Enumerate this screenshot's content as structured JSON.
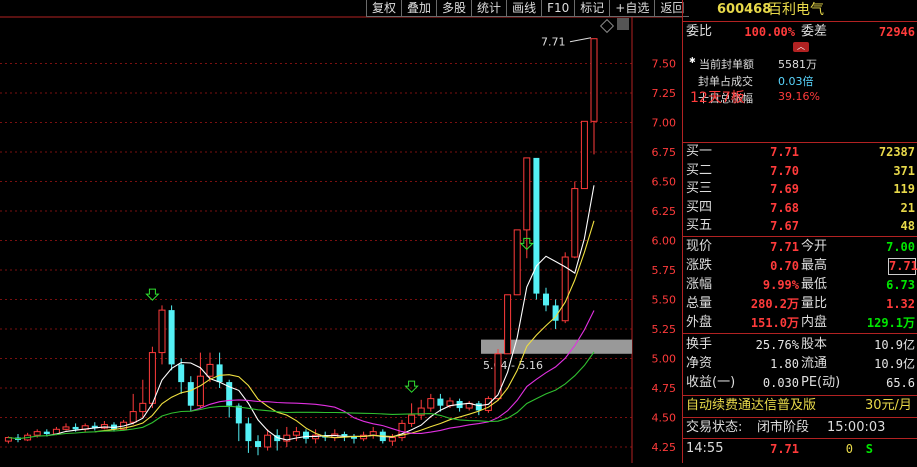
{
  "toolbar": [
    {
      "id": "fuquan",
      "label": "复权"
    },
    {
      "id": "diejia",
      "label": "叠加"
    },
    {
      "id": "duogu",
      "label": "多股"
    },
    {
      "id": "tongji",
      "label": "统计"
    },
    {
      "id": "huaxian",
      "label": "画线"
    },
    {
      "id": "f10",
      "label": "F10"
    },
    {
      "id": "biaoji",
      "label": "标记"
    },
    {
      "id": "zixuan",
      "label": "+自选"
    },
    {
      "id": "fanhui",
      "label": "返回"
    }
  ],
  "chart": {
    "price_axis": [
      "7.50",
      "7.25",
      "7.00",
      "6.75",
      "6.50",
      "6.25",
      "6.00",
      "5.75",
      "5.50",
      "5.25",
      "5.00",
      "4.75",
      "4.50",
      "4.25"
    ],
    "price_min": 4.25,
    "price_max": 7.75,
    "high_label": "7.71",
    "range_label": "5.04 - 5.16",
    "panel_title": "12天7板",
    "seal_amount_label": "当前封单额",
    "seal_amount_value": "5581万",
    "seal_ratio_label": "封单占成交",
    "seal_ratio_value": "0.03倍",
    "ten_day_label": "十日总涨幅",
    "ten_day_value": "39.16%",
    "candles": [
      [
        4.3,
        4.33,
        4.34,
        4.28
      ],
      [
        4.33,
        4.31,
        4.36,
        4.29
      ],
      [
        4.31,
        4.35,
        4.37,
        4.3
      ],
      [
        4.35,
        4.38,
        4.4,
        4.33
      ],
      [
        4.38,
        4.36,
        4.4,
        4.34
      ],
      [
        4.36,
        4.4,
        4.42,
        4.35
      ],
      [
        4.4,
        4.42,
        4.45,
        4.39
      ],
      [
        4.42,
        4.4,
        4.45,
        4.38
      ],
      [
        4.4,
        4.43,
        4.45,
        4.38
      ],
      [
        4.43,
        4.41,
        4.46,
        4.39
      ],
      [
        4.41,
        4.44,
        4.47,
        4.4
      ],
      [
        4.44,
        4.4,
        4.46,
        4.38
      ],
      [
        4.4,
        4.46,
        4.48,
        4.39
      ],
      [
        4.46,
        4.55,
        4.7,
        4.44
      ],
      [
        4.55,
        4.62,
        4.82,
        4.5
      ],
      [
        4.62,
        5.05,
        5.1,
        4.58
      ],
      [
        5.05,
        5.41,
        5.45,
        4.95
      ],
      [
        5.41,
        4.95,
        5.45,
        4.9
      ],
      [
        4.95,
        4.8,
        5.0,
        4.7
      ],
      [
        4.8,
        4.6,
        4.85,
        4.55
      ],
      [
        4.6,
        4.85,
        5.05,
        4.58
      ],
      [
        4.85,
        4.95,
        5.05,
        4.8
      ],
      [
        4.95,
        4.8,
        5.05,
        4.75
      ],
      [
        4.8,
        4.6,
        4.82,
        4.5
      ],
      [
        4.6,
        4.45,
        4.62,
        4.3
      ],
      [
        4.45,
        4.3,
        4.5,
        4.2
      ],
      [
        4.3,
        4.25,
        4.35,
        4.18
      ],
      [
        4.25,
        4.35,
        4.4,
        4.22
      ],
      [
        4.35,
        4.3,
        4.4,
        4.22
      ],
      [
        4.3,
        4.35,
        4.42,
        4.25
      ],
      [
        4.35,
        4.38,
        4.42,
        4.3
      ],
      [
        4.38,
        4.32,
        4.4,
        4.28
      ],
      [
        4.32,
        4.35,
        4.4,
        4.28
      ],
      [
        4.35,
        4.33,
        4.38,
        4.3
      ],
      [
        4.33,
        4.36,
        4.4,
        4.3
      ],
      [
        4.36,
        4.34,
        4.38,
        4.3
      ],
      [
        4.34,
        4.32,
        4.36,
        4.28
      ],
      [
        4.32,
        4.35,
        4.38,
        4.3
      ],
      [
        4.35,
        4.38,
        4.42,
        4.32
      ],
      [
        4.38,
        4.3,
        4.4,
        4.28
      ],
      [
        4.3,
        4.33,
        4.36,
        4.26
      ],
      [
        4.33,
        4.45,
        4.48,
        4.3
      ],
      [
        4.45,
        4.52,
        4.62,
        4.42
      ],
      [
        4.52,
        4.58,
        4.65,
        4.48
      ],
      [
        4.58,
        4.66,
        4.7,
        4.55
      ],
      [
        4.66,
        4.6,
        4.7,
        4.55
      ],
      [
        4.6,
        4.64,
        4.67,
        4.58
      ],
      [
        4.64,
        4.58,
        4.66,
        4.55
      ],
      [
        4.58,
        4.62,
        4.64,
        4.56
      ],
      [
        4.62,
        4.56,
        4.64,
        4.52
      ],
      [
        4.56,
        4.66,
        4.68,
        4.54
      ],
      [
        4.66,
        5.04,
        5.08,
        4.64
      ],
      [
        5.04,
        5.54,
        5.54,
        5.15
      ],
      [
        5.54,
        6.09,
        6.09,
        5.8
      ],
      [
        6.09,
        6.7,
        6.7,
        5.85
      ],
      [
        6.7,
        5.55,
        5.75,
        5.5
      ],
      [
        5.55,
        5.45,
        5.6,
        5.4
      ],
      [
        5.45,
        5.32,
        5.5,
        5.25
      ],
      [
        5.32,
        5.86,
        5.9,
        5.3
      ],
      [
        5.86,
        6.44,
        6.5,
        5.85
      ],
      [
        6.44,
        7.01,
        7.01,
        6.44
      ],
      [
        7.01,
        7.71,
        7.71,
        6.73
      ]
    ]
  },
  "quote": {
    "code": "600468",
    "name": "百利电气",
    "weibi_label": "委比",
    "weibi_value": "100.00%",
    "weicha_label": "委差",
    "weicha_value": "72946",
    "buy": [
      {
        "label": "买一",
        "price": "7.71",
        "vol": "72387"
      },
      {
        "label": "买二",
        "price": "7.70",
        "vol": "371"
      },
      {
        "label": "买三",
        "price": "7.69",
        "vol": "119"
      },
      {
        "label": "买四",
        "price": "7.68",
        "vol": "21"
      },
      {
        "label": "买五",
        "price": "7.67",
        "vol": "48"
      }
    ],
    "stats": [
      {
        "l1": "现价",
        "v1": "7.71",
        "l2": "今开",
        "v2": "7.00",
        "c2": "green"
      },
      {
        "l1": "涨跌",
        "v1": "0.70",
        "l2": "最高",
        "v2": "7.71",
        "c2": "red"
      },
      {
        "l1": "涨幅",
        "v1": "9.99%",
        "l2": "最低",
        "v2": "6.73",
        "c2": "green"
      },
      {
        "l1": "总量",
        "v1": "280.2万",
        "l2": "量比",
        "v2": "1.32",
        "c2": "red"
      },
      {
        "l1": "外盘",
        "v1": "151.0万",
        "l2": "内盘",
        "v2": "129.1万",
        "c2": "green"
      }
    ],
    "stats2": [
      {
        "l1": "换手",
        "v1": "25.76%",
        "l2": "股本",
        "v2": "10.9亿"
      },
      {
        "l1": "净资",
        "v1": "1.80",
        "l2": "流通",
        "v2": "10.9亿"
      },
      {
        "l1": "收益(一)",
        "v1": "0.030",
        "l2": "PE(动)",
        "v2": "65.6"
      }
    ],
    "ad_text": "自动续费通达信普及版",
    "ad_price": "30元/月",
    "status_label": "交易状态:",
    "status_value": "闭市阶段",
    "status_time": "15:00:03",
    "ticks": [
      {
        "time": "14:55",
        "price": "7.71",
        "vol": "0",
        "flag": "S"
      }
    ]
  }
}
